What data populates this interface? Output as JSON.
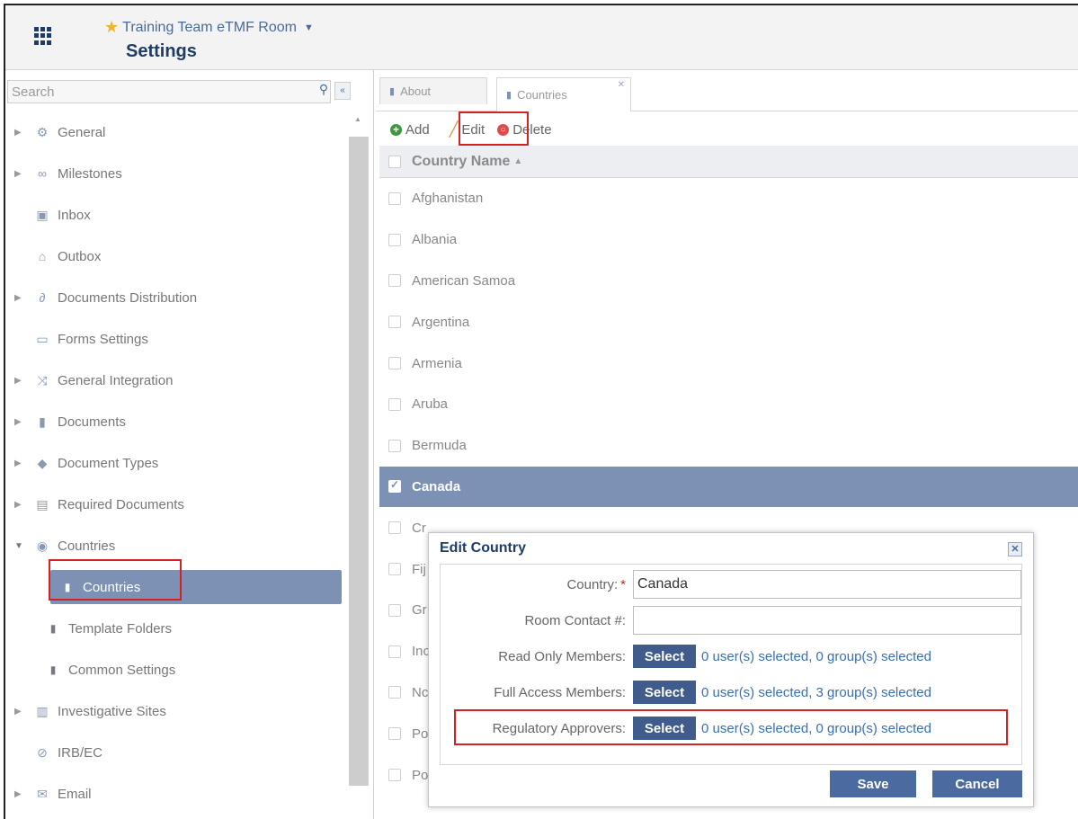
{
  "header": {
    "room_name": "Training Team eTMF Room",
    "page_title": "Settings"
  },
  "sidebar": {
    "search_placeholder": "Search",
    "items": [
      {
        "label": "General",
        "icon": "gear-icon",
        "expandable": true
      },
      {
        "label": "Milestones",
        "icon": "milestones-icon",
        "expandable": true
      },
      {
        "label": "Inbox",
        "icon": "inbox-icon",
        "expandable": false
      },
      {
        "label": "Outbox",
        "icon": "outbox-icon",
        "expandable": false
      },
      {
        "label": "Documents Distribution",
        "icon": "link-icon",
        "expandable": true
      },
      {
        "label": "Forms Settings",
        "icon": "form-icon",
        "expandable": false
      },
      {
        "label": "General Integration",
        "icon": "shuffle-icon",
        "expandable": true
      },
      {
        "label": "Documents",
        "icon": "document-icon",
        "expandable": true
      },
      {
        "label": "Document Types",
        "icon": "tag-icon",
        "expandable": true
      },
      {
        "label": "Required Documents",
        "icon": "clipboard-icon",
        "expandable": true
      },
      {
        "label": "Countries",
        "icon": "globe-icon",
        "expandable": true,
        "expanded": true
      },
      {
        "label": "Countries",
        "icon": "document-icon",
        "child": true,
        "selected": true
      },
      {
        "label": "Template Folders",
        "icon": "document-icon",
        "child": true
      },
      {
        "label": "Common Settings",
        "icon": "document-icon",
        "child": true
      },
      {
        "label": "Investigative Sites",
        "icon": "building-icon",
        "expandable": true
      },
      {
        "label": "IRB/EC",
        "icon": "check-circle-icon",
        "expandable": false
      },
      {
        "label": "Email",
        "icon": "email-icon",
        "expandable": true
      }
    ]
  },
  "tabs": [
    {
      "label": "About",
      "active": false
    },
    {
      "label": "Countries",
      "active": true
    }
  ],
  "toolbar": {
    "add_label": "Add",
    "edit_label": "Edit",
    "delete_label": "Delete"
  },
  "grid": {
    "column_header": "Country Name",
    "rows": [
      {
        "name": "Afghanistan",
        "selected": false
      },
      {
        "name": "Albania",
        "selected": false
      },
      {
        "name": "American Samoa",
        "selected": false
      },
      {
        "name": "Argentina",
        "selected": false
      },
      {
        "name": "Armenia",
        "selected": false
      },
      {
        "name": "Aruba",
        "selected": false
      },
      {
        "name": "Bermuda",
        "selected": false
      },
      {
        "name": "Canada",
        "selected": true
      },
      {
        "name": "Cr",
        "selected": false
      },
      {
        "name": "Fij",
        "selected": false
      },
      {
        "name": "Gr",
        "selected": false
      },
      {
        "name": "Inc",
        "selected": false
      },
      {
        "name": "Nc",
        "selected": false
      },
      {
        "name": "Po",
        "selected": false
      },
      {
        "name": "Po",
        "selected": false
      }
    ]
  },
  "dialog": {
    "title": "Edit Country",
    "country_label": "Country:",
    "country_value": "Canada",
    "room_contact_label": "Room Contact #:",
    "room_contact_value": "",
    "read_only_label": "Read Only Members:",
    "read_only_text": "0 user(s) selected, 0 group(s) selected",
    "full_access_label": "Full Access Members:",
    "full_access_text": "0 user(s) selected, 3 group(s) selected",
    "regulatory_label": "Regulatory Approvers:",
    "regulatory_text": "0 user(s) selected, 0 group(s) selected",
    "select_label": "Select",
    "save_label": "Save",
    "cancel_label": "Cancel"
  },
  "colors": {
    "accent": "#7c91b3",
    "title_blue": "#1e3c66",
    "button_blue": "#3f5c8c",
    "highlight_red": "#d42121"
  }
}
